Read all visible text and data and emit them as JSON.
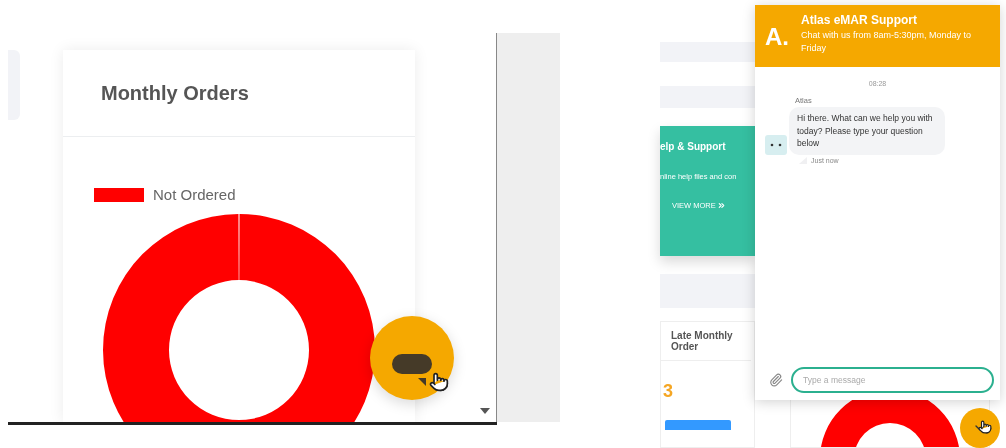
{
  "orders_card": {
    "title": "Monthly Orders",
    "legend": [
      {
        "label": "Not Ordered",
        "color": "#ff0000"
      }
    ]
  },
  "help_card": {
    "title": "elp & Support",
    "text": "nline help files and con",
    "link": "VIEW MORE"
  },
  "late_card": {
    "title": "Late Monthly Order",
    "value": "3"
  },
  "chat": {
    "logo": "A.",
    "title": "Atlas eMAR Support",
    "subtitle": "Chat with us from 8am-5:30pm, Monday to Friday",
    "time": "08:28",
    "sender": "Atlas",
    "message": "Hi there. What can we help you with today? Please type your question below",
    "status": "Just now",
    "placeholder": "Type a message"
  }
}
